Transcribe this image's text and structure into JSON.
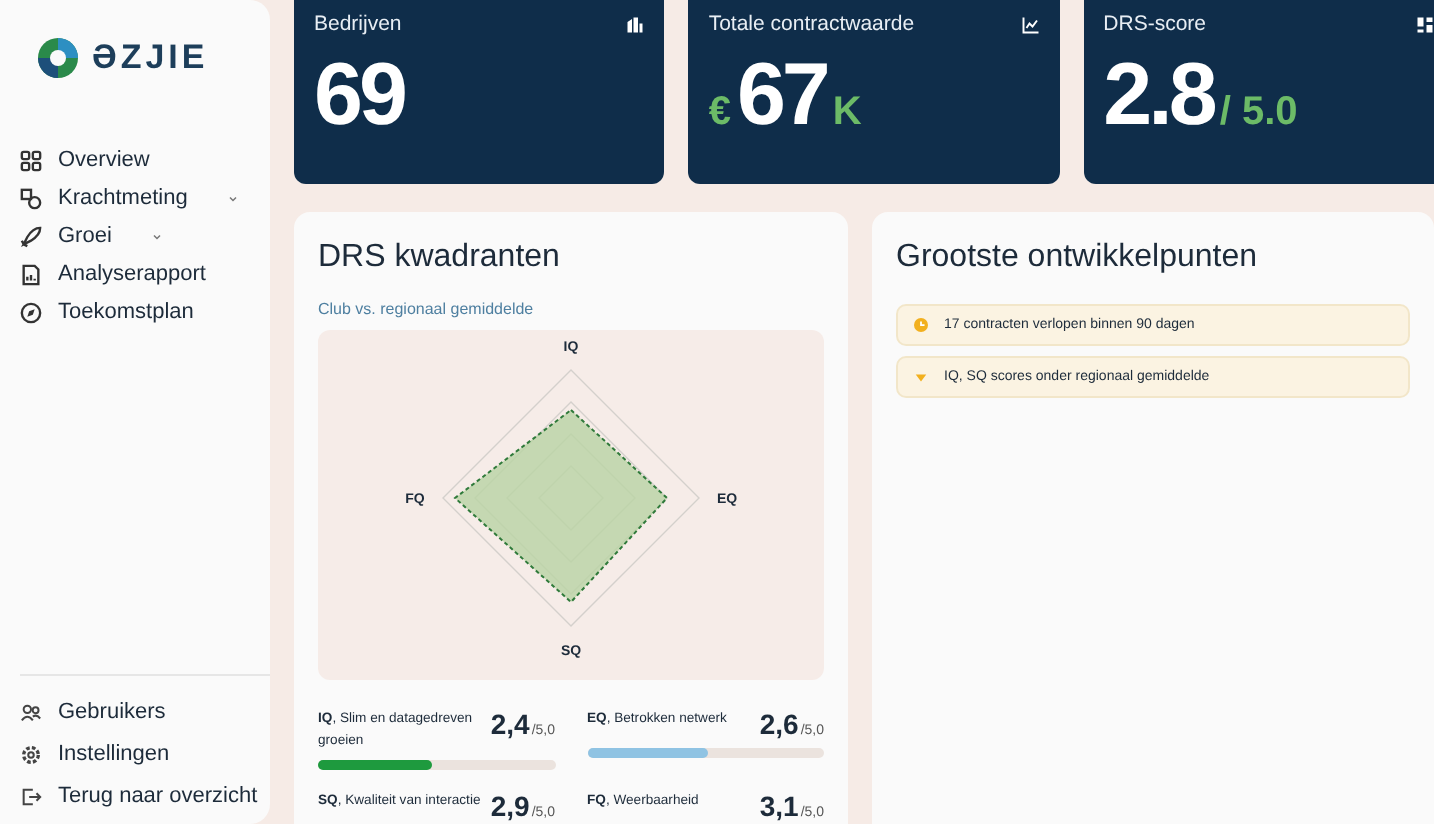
{
  "sidebar": {
    "logo": "ƏZJIE",
    "items": [
      {
        "label": "Overview",
        "has_submenu": false
      },
      {
        "label": "Krachtmeting",
        "has_submenu": true
      },
      {
        "label": "Groei",
        "has_submenu": true
      },
      {
        "label": "Analyserapport",
        "has_submenu": false
      },
      {
        "label": "Toekomstplan",
        "has_submenu": false
      }
    ],
    "footer_items": [
      {
        "label": "Gebruikers"
      },
      {
        "label": "Instellingen"
      },
      {
        "label": "Terug naar overzicht"
      }
    ]
  },
  "stats": [
    {
      "label": "Bedrijven",
      "value": "69"
    },
    {
      "label": "Totale contractwaarde",
      "prefix": "€",
      "value": "67",
      "suffix": "K"
    },
    {
      "label": "DRS-score",
      "value": "2.8",
      "suffix": "/ 5.0"
    }
  ],
  "quadrants": {
    "title": "DRS kwadranten",
    "subtitle": "Club vs. regionaal gemiddelde",
    "axes": [
      "IQ",
      "EQ",
      "SQ",
      "FQ"
    ],
    "scores": [
      {
        "label": "**IQ**, Slim en datagedreven groeien",
        "score": "2,4",
        "max": "/5,0",
        "level": 0.48,
        "color": "#1e9a3e"
      },
      {
        "label": "**EQ**, Betrokken netwerk",
        "score": "2,6",
        "max": "/5,0",
        "level": 0.51,
        "color": "#8fc3e3"
      },
      {
        "label": "**SQ**, Kwaliteit van interactie",
        "score": "2,9",
        "max": "/5,0"
      },
      {
        "label": "**FQ**, Weerbaarheid",
        "score": "3,1",
        "max": "/5,0"
      }
    ]
  },
  "development": {
    "title": "Grootste ontwikkelpunten",
    "items": [
      {
        "kind": "dot",
        "text": "17 contracten verlopen binnen 90 dagen"
      },
      {
        "kind": "dash",
        "text": "IQ, SQ scores onder regionaal gemiddelde"
      }
    ]
  }
}
